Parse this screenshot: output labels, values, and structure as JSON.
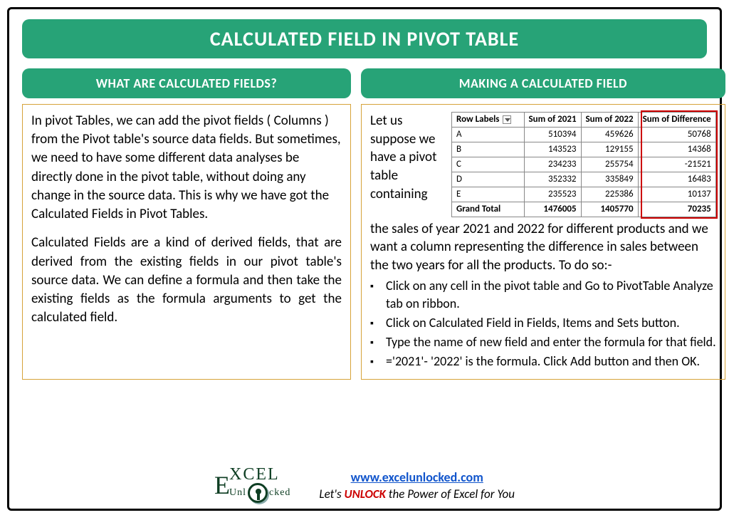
{
  "title": "CALCULATED FIELD IN PIVOT TABLE",
  "left": {
    "header": "WHAT ARE CALCULATED FIELDS?",
    "para1": "In pivot Tables, we can add the pivot fields ( Columns ) from the Pivot table's source data fields. But sometimes, we need to have some different data analyses be directly done in the pivot table, without doing any change in the source data. This is why we have got the Calculated Fields in Pivot Tables.",
    "para2": "Calculated Fields are a kind of derived fields, that are derived from the existing fields in our pivot table's source data. We can define a formula and then take the existing fields as the formula arguments to get the calculated field."
  },
  "right": {
    "header": "MAKING A CALCULATED FIELD",
    "lead": "Let us suppose we have a pivot table containing",
    "continuation": "the sales of year 2021 and 2022 for different products and we want a column representing the difference in sales between the two years for all the products. To do so:-",
    "steps": [
      "Click on any cell in the pivot table and Go to PivotTable Analyze tab on ribbon.",
      "Click on Calculated Field in Fields, Items and Sets button.",
      "Type the name of new field and enter the formula for that field.",
      "='2021'- '2022' is the formula. Click Add button and then OK."
    ],
    "table": {
      "headers": [
        "Row Labels",
        "Sum of 2021",
        "Sum of 2022",
        "Sum of Difference"
      ],
      "rows": [
        {
          "label": "A",
          "v1": "510394",
          "v2": "459626",
          "diff": "50768"
        },
        {
          "label": "B",
          "v1": "143523",
          "v2": "129155",
          "diff": "14368"
        },
        {
          "label": "C",
          "v1": "234233",
          "v2": "255754",
          "diff": "-21521"
        },
        {
          "label": "D",
          "v1": "352332",
          "v2": "335849",
          "diff": "16483"
        },
        {
          "label": "E",
          "v1": "235523",
          "v2": "225386",
          "diff": "10137"
        }
      ],
      "total": {
        "label": "Grand Total",
        "v1": "1476005",
        "v2": "1405770",
        "diff": "70235"
      }
    }
  },
  "footer": {
    "logo_top": "XCEL",
    "logo_big": "E",
    "logo_bot": "Unl   cked",
    "url": "www.excelunlocked.com",
    "tagline_pre": "Let's ",
    "tagline_unlock": "UNLOCK",
    "tagline_post": " the Power of Excel for You"
  }
}
